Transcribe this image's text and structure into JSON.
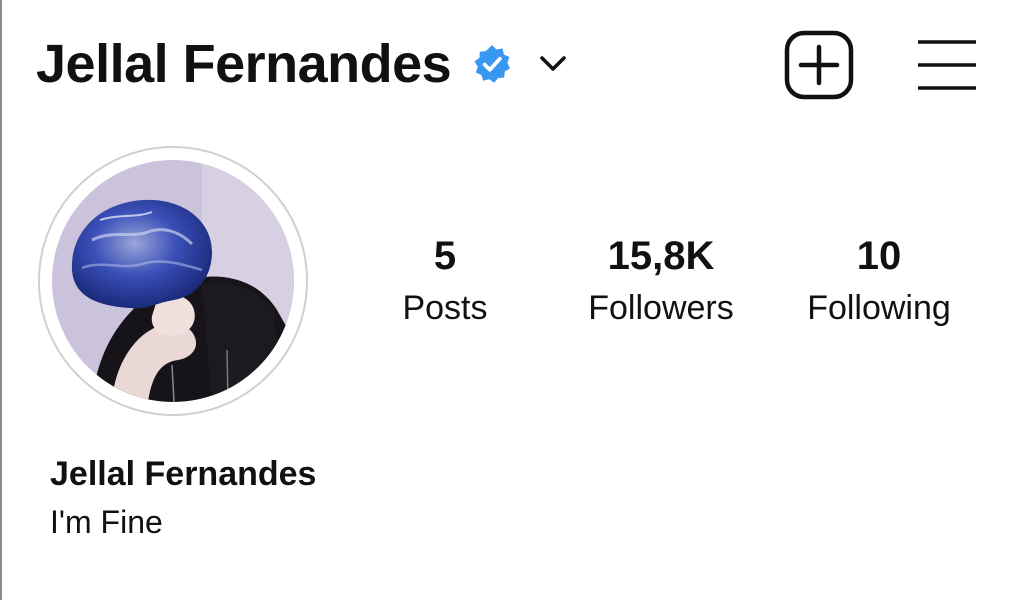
{
  "header": {
    "username": "Jellal Fernandes",
    "verified_icon": "verified-badge",
    "dropdown_icon": "chevron-down",
    "new_post_icon": "plus-square",
    "menu_icon": "hamburger-menu"
  },
  "profile": {
    "avatar_icon": "profile-photo",
    "display_name": "Jellal Fernandes",
    "bio": "I'm Fine"
  },
  "stats": [
    {
      "value": "5",
      "label": "Posts"
    },
    {
      "value": "15,8K",
      "label": "Followers"
    },
    {
      "value": "10",
      "label": "Following"
    }
  ],
  "colors": {
    "verified": "#3897f0",
    "text": "#111111",
    "background": "#ffffff"
  }
}
